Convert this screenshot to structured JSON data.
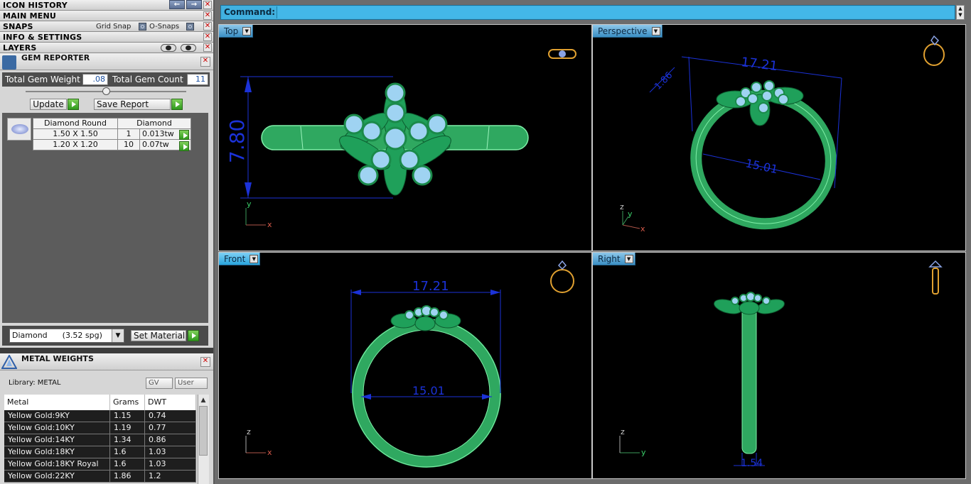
{
  "left_panel": {
    "menus": [
      {
        "label": "ICON HISTORY"
      },
      {
        "label": "MAIN MENU"
      },
      {
        "label": "SNAPS"
      },
      {
        "label": "INFO & SETTINGS"
      },
      {
        "label": "LAYERS"
      }
    ],
    "snaps": {
      "grid_snap": "Grid Snap",
      "o_snaps": "O-Snaps"
    },
    "nav_arrows": {
      "back": "←",
      "forward": "→"
    },
    "close_glyph": "✕"
  },
  "gem_reporter": {
    "title": "GEM REPORTER",
    "total_weight_label": "Total Gem Weight",
    "total_weight_value": ".08",
    "total_count_label": "Total Gem Count",
    "total_count_value": "11",
    "update_label": "Update",
    "save_report_label": "Save Report",
    "table": {
      "headers": [
        "Diamond Round",
        "Diamond"
      ],
      "rows": [
        {
          "size": "1.50 X 1.50",
          "count": "1",
          "weight": "0.013tw"
        },
        {
          "size": "1.20 X 1.20",
          "count": "10",
          "weight": "0.07tw"
        }
      ]
    },
    "material_select": "Diamond      (3.52 spg)",
    "set_material_label": "Set Material"
  },
  "metal_weights": {
    "title": "METAL WEIGHTS",
    "library_label": "Library: METAL",
    "gv_label": "GV",
    "user_label": "User",
    "headers": [
      "Metal",
      "Grams",
      "DWT"
    ],
    "rows": [
      {
        "metal": "Yellow Gold:9KY",
        "grams": "1.15",
        "dwt": "0.74"
      },
      {
        "metal": "Yellow Gold:10KY",
        "grams": "1.19",
        "dwt": "0.77"
      },
      {
        "metal": "Yellow Gold:14KY",
        "grams": "1.34",
        "dwt": "0.86"
      },
      {
        "metal": "Yellow Gold:18KY",
        "grams": "1.6",
        "dwt": "1.03"
      },
      {
        "metal": "Yellow Gold:18KY Royal",
        "grams": "1.6",
        "dwt": "1.03"
      },
      {
        "metal": "Yellow Gold:22KY",
        "grams": "1.86",
        "dwt": "1.2"
      }
    ]
  },
  "command": {
    "label": "Command:",
    "value": ""
  },
  "viewports": {
    "top": {
      "tab": "Top",
      "dim_height": "7.80",
      "axis_y": "y",
      "axis_x": "x"
    },
    "perspective": {
      "tab": "Perspective",
      "dim_width": "17.21",
      "dim_inner": "15.01",
      "dim_small": "1.86",
      "axis_z": "z",
      "axis_y": "y",
      "axis_x": "x"
    },
    "front": {
      "tab": "Front",
      "dim_width": "17.21",
      "dim_inner": "15.01",
      "axis_z": "z",
      "axis_x": "x"
    },
    "right": {
      "tab": "Right",
      "dim_thickness": "1.54",
      "axis_z": "z",
      "axis_y": "y"
    }
  },
  "colors": {
    "ring_green": "#3fd27a",
    "ring_dark": "#1f8a4a",
    "leaf_green": "#1fa05a",
    "gem_blue": "#9fd3f2",
    "dimension_blue": "#1b32d8",
    "command_bar": "#41b1e0",
    "viewport_tab": "#5aa9d8"
  }
}
